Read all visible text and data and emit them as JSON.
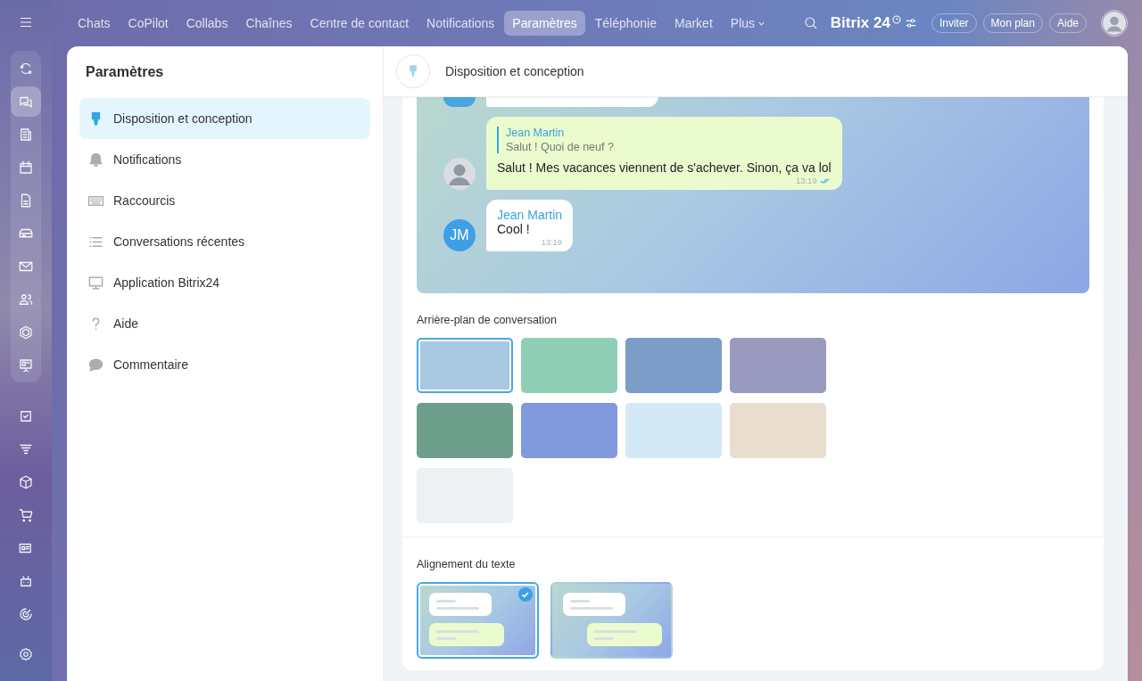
{
  "top_nav": {
    "tabs": [
      {
        "label": "Chats",
        "selected": false
      },
      {
        "label": "CoPilot",
        "selected": false
      },
      {
        "label": "Collabs",
        "selected": false
      },
      {
        "label": "Chaînes",
        "selected": false
      },
      {
        "label": "Centre de contact",
        "selected": false
      },
      {
        "label": "Notifications",
        "selected": false
      },
      {
        "label": "Paramètres",
        "selected": true
      },
      {
        "label": "Téléphonie",
        "selected": false
      },
      {
        "label": "Market",
        "selected": false
      },
      {
        "label": "Plus",
        "selected": false,
        "has_menu": true
      }
    ],
    "logo": "Bitrix 24",
    "buttons": [
      "Inviter",
      "Mon plan",
      "Aide"
    ]
  },
  "rail_pinned": [
    {
      "selected": false
    },
    {
      "selected": true
    },
    {
      "selected": false
    },
    {
      "selected": false
    },
    {
      "selected": false
    },
    {
      "selected": false
    },
    {
      "selected": false
    },
    {
      "selected": false
    },
    {
      "selected": false
    },
    {
      "selected": false
    }
  ],
  "rail_more": [
    {
      "selected": false
    },
    {
      "selected": false
    },
    {
      "selected": false
    },
    {
      "selected": false
    },
    {
      "selected": false
    },
    {
      "selected": false
    },
    {
      "selected": false
    }
  ],
  "sidebar": {
    "title": "Paramètres",
    "items": [
      {
        "label": "Disposition et conception",
        "selected": true
      },
      {
        "label": "Notifications",
        "selected": false
      },
      {
        "label": "Raccourcis",
        "selected": false
      },
      {
        "label": "Conversations récentes",
        "selected": false
      },
      {
        "label": "Application Bitrix24",
        "selected": false
      },
      {
        "label": "Aide",
        "selected": false
      },
      {
        "label": "Commentaire",
        "selected": false
      }
    ]
  },
  "header": {
    "title": "Disposition et conception"
  },
  "chat_preview": {
    "messages": [
      {
        "avatar": {
          "kind": "photo"
        },
        "reply_to": {
          "author": "Jean Martin",
          "text": "Salut ! Quoi de neuf ?"
        },
        "text": "Salut ! Mes vacances viennent de s'achever. Sinon, ça va lol",
        "time": "13:19",
        "read": true,
        "outgoing": true
      },
      {
        "avatar": {
          "kind": "initials",
          "initials": "JM"
        },
        "author": "Jean Martin",
        "text": "Cool !",
        "time": "13:19",
        "read": false,
        "outgoing": false
      }
    ]
  },
  "backgrounds": {
    "title": "Arrière-plan de conversation",
    "items": [
      {
        "color": "#a9c8e2",
        "selected": true
      },
      {
        "color": "#8fcfb6",
        "selected": false
      },
      {
        "color": "#7b9dc8",
        "selected": false
      },
      {
        "color": "#9a9ac0",
        "selected": false
      },
      {
        "color": "#6e9f8c",
        "selected": false
      },
      {
        "color": "#8199dd",
        "selected": false
      },
      {
        "color": "#d3eaf6",
        "selected": false
      },
      {
        "color": "#e9ddd0",
        "selected": false
      },
      {
        "color": "#eef1f4",
        "selected": false
      }
    ]
  },
  "alignment": {
    "title": "Alignement du texte",
    "options": [
      {
        "kind": "left",
        "selected": true
      },
      {
        "kind": "split",
        "selected": false
      }
    ]
  }
}
